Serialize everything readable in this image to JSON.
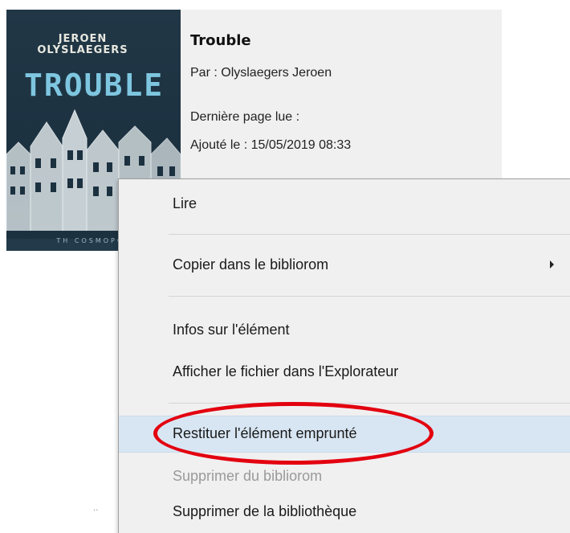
{
  "book": {
    "cover": {
      "author_line1": "JEROEN",
      "author_line2": "OLYSLAEGERS",
      "title": "TROUBLE",
      "footer": "TH COSMOPOL"
    },
    "title": "Trouble",
    "author_label": "Par :",
    "author": "Olyslaegers Jeroen",
    "last_page_label": "Dernière page lue :",
    "added_label": "Ajouté le :",
    "added_date": "15/05/2019 08:33"
  },
  "context_menu": {
    "items": [
      {
        "label": "Lire"
      },
      {
        "label": "Copier dans le bibliorom",
        "has_submenu": true
      },
      {
        "label": "Infos sur l'élément"
      },
      {
        "label": "Afficher le fichier dans l'Explorateur"
      },
      {
        "label": "Restituer l'élément emprunté",
        "highlighted": true
      },
      {
        "label": "Supprimer du bibliorom",
        "disabled": true
      },
      {
        "label": "Supprimer de la bibliothèque"
      }
    ]
  },
  "colors": {
    "menu_background": "#f0f0f0",
    "highlight": "#d8e6f3",
    "annotation": "#e3000f",
    "cover_background": "#1c3140",
    "cover_title": "#7ec6e0"
  }
}
